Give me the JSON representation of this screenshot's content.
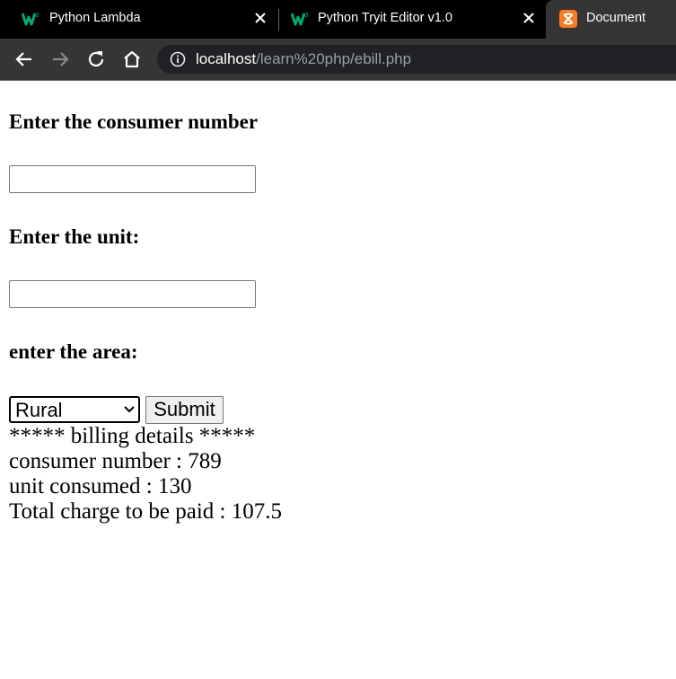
{
  "browser": {
    "tabs": [
      {
        "title": "Python Lambda",
        "icon": "w3schools-icon",
        "active": false
      },
      {
        "title": "Python Tryit Editor v1.0",
        "icon": "w3schools-icon",
        "active": false
      },
      {
        "title": "Document",
        "icon": "xampp-icon",
        "active": true
      }
    ],
    "url_host": "localhost",
    "url_path": "/learn%20php/ebill.php",
    "colors": {
      "tabstrip": "#000000",
      "active_tab": "#353535",
      "omnibox": "#202124",
      "w3_green": "#04aa6d",
      "xampp_orange": "#fb7a24"
    }
  },
  "form": {
    "consumer_label": "Enter the consumer number",
    "consumer_value": "",
    "unit_label": "Enter the unit:",
    "unit_value": "",
    "area_label": "enter the area:",
    "area_selected": "Rural",
    "submit_label": "Submit"
  },
  "output": {
    "header": "***** billing details *****",
    "consumer_line": "consumer number : 789",
    "unit_line": "unit consumed : 130",
    "total_line": "Total charge to be paid : 107.5"
  }
}
